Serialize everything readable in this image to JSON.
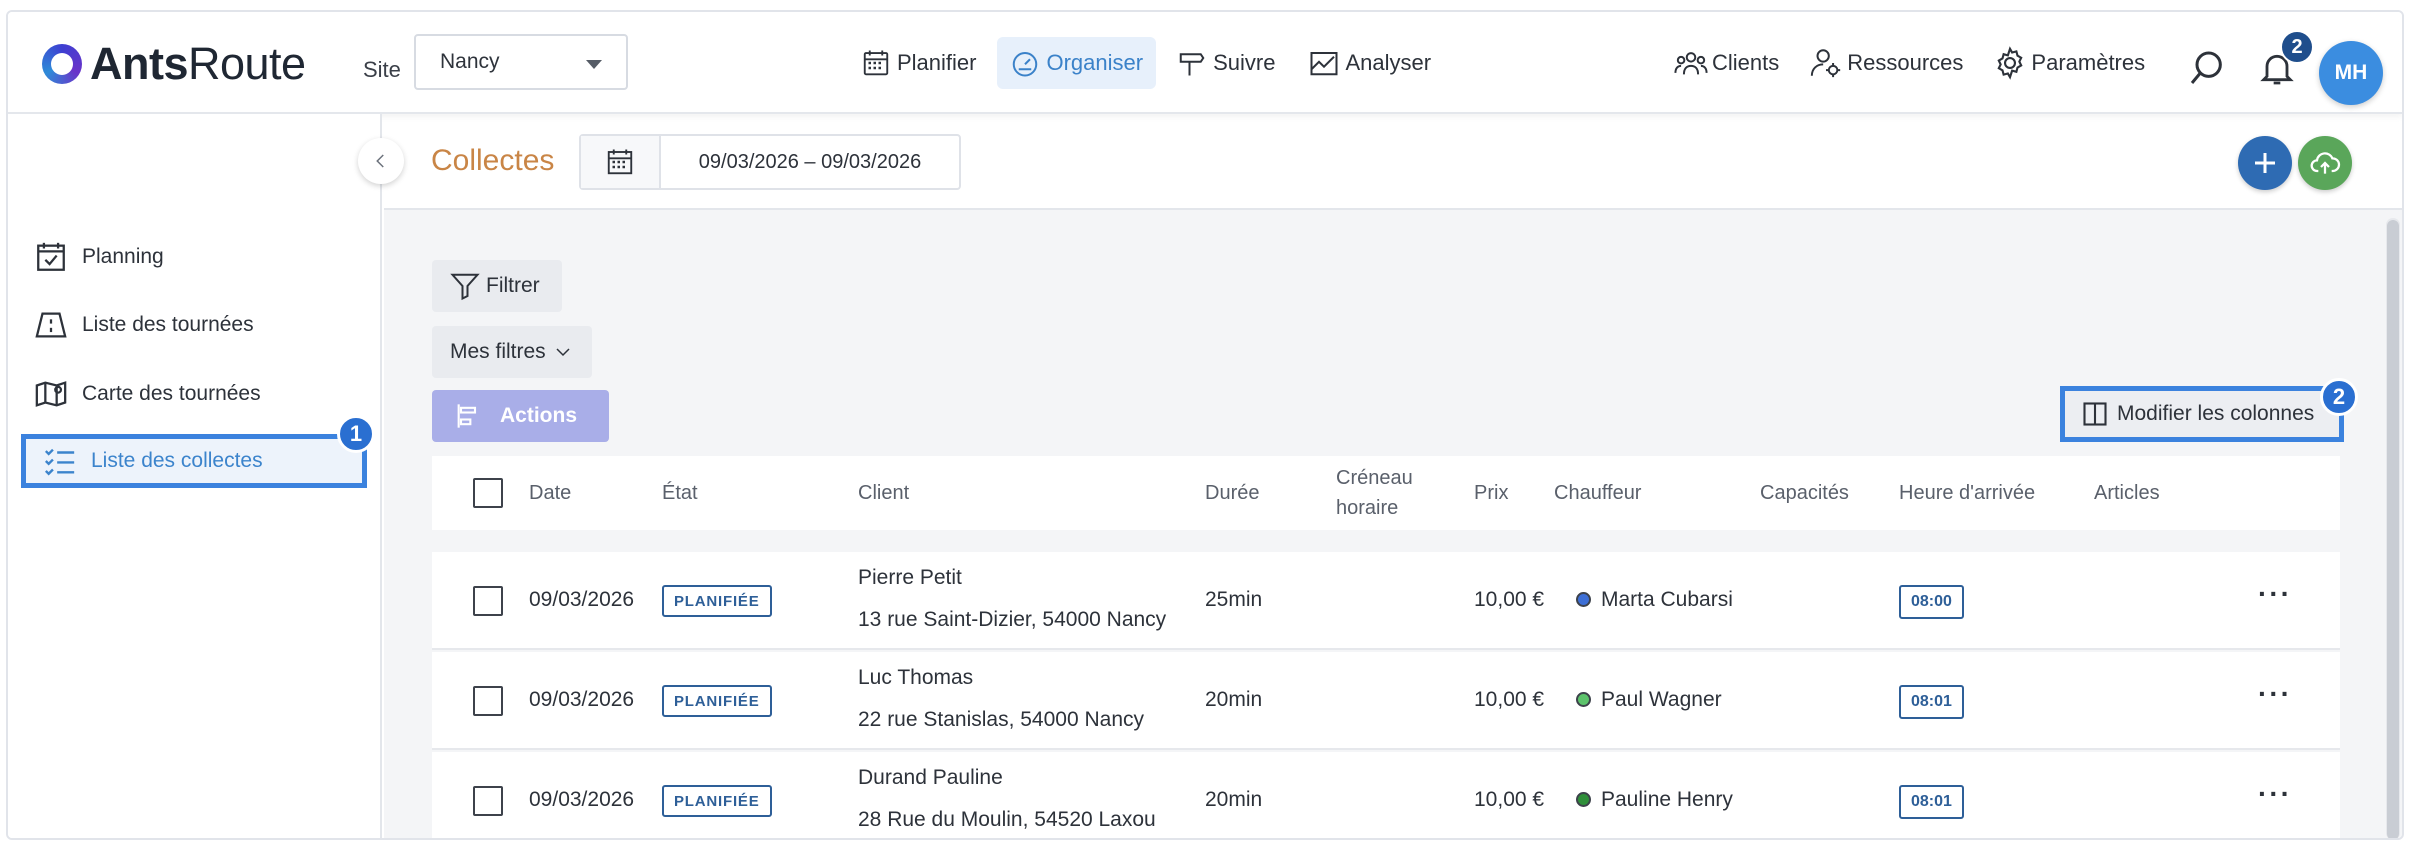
{
  "app": {
    "logo_bold": "Ants",
    "logo_light": "Route",
    "site_label": "Site",
    "site_value": "Nancy"
  },
  "nav": {
    "main": [
      {
        "label": "Planifier",
        "icon": "calendar-icon"
      },
      {
        "label": "Organiser",
        "icon": "speedometer-icon",
        "active": true
      },
      {
        "label": "Suivre",
        "icon": "signpost-icon"
      },
      {
        "label": "Analyser",
        "icon": "chart-icon"
      }
    ],
    "right": [
      {
        "label": "Clients",
        "icon": "people-icon"
      },
      {
        "label": "Ressources",
        "icon": "user-gear-icon"
      },
      {
        "label": "Paramètres",
        "icon": "gear-icon"
      }
    ],
    "notification_count": "2",
    "avatar_initials": "MH"
  },
  "sidebar": {
    "items": [
      {
        "label": "Planning",
        "icon": "calendar-check-icon"
      },
      {
        "label": "Liste des tournées",
        "icon": "route-icon"
      },
      {
        "label": "Carte des tournées",
        "icon": "map-pin-icon"
      },
      {
        "label": "Liste des collectes",
        "icon": "checklist-icon",
        "active": true
      }
    ],
    "step_badge": "1"
  },
  "page": {
    "title": "Collectes",
    "date_range": "09/03/2026 – 09/03/2026"
  },
  "toolbar": {
    "filter_label": "Filtrer",
    "my_filters_label": "Mes filtres",
    "actions_label": "Actions",
    "modify_columns_label": "Modifier les colonnes",
    "step_badge": "2"
  },
  "table": {
    "columns": [
      "Date",
      "État",
      "Client",
      "Durée",
      "Créneau horaire",
      "Prix",
      "Chauffeur",
      "Capacités",
      "Heure d'arrivée",
      "Articles"
    ],
    "rows": [
      {
        "date": "09/03/2026",
        "status": "PLANIFIÉE",
        "client_name": "Pierre Petit",
        "client_address": "13 rue Saint-Dizier, 54000 Nancy",
        "duration": "25min",
        "price": "10,00 €",
        "driver": "Marta Cubarsi",
        "driver_color": "#3d6fd6",
        "arrival": "08:00"
      },
      {
        "date": "09/03/2026",
        "status": "PLANIFIÉE",
        "client_name": "Luc Thomas",
        "client_address": "22 rue Stanislas, 54000 Nancy",
        "duration": "20min",
        "price": "10,00 €",
        "driver": "Paul Wagner",
        "driver_color": "#5cc36b",
        "arrival": "08:01"
      },
      {
        "date": "09/03/2026",
        "status": "PLANIFIÉE",
        "client_name": "Durand Pauline",
        "client_address": "28 Rue du Moulin, 54520 Laxou",
        "duration": "20min",
        "price": "10,00 €",
        "driver": "Pauline Henry",
        "driver_color": "#2f8f3a",
        "arrival": "08:01"
      }
    ]
  },
  "colors": {
    "accent": "#3b82de",
    "title": "#c98546",
    "add_button": "#2e6bb3",
    "upload_button": "#5aa65a"
  }
}
